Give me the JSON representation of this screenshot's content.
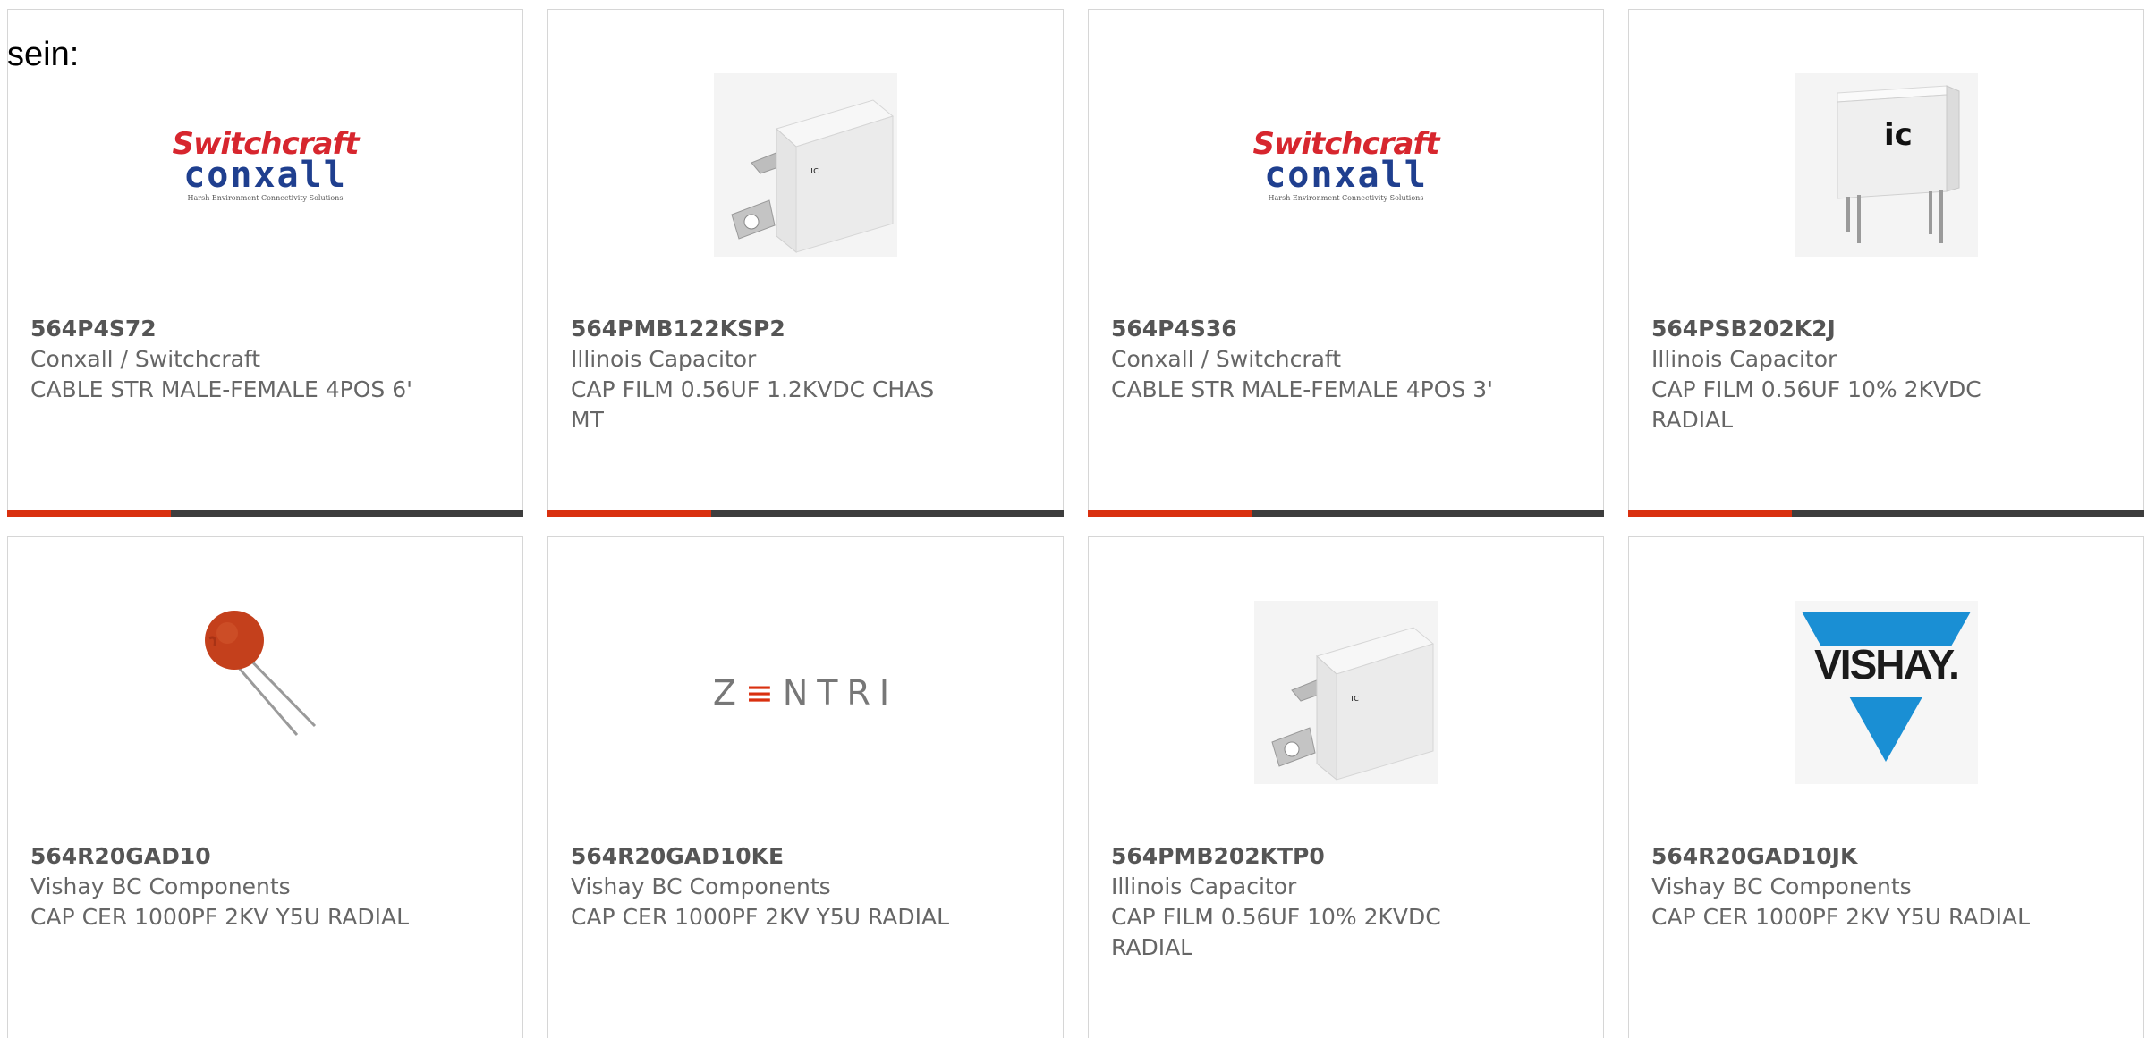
{
  "intro": "sein:",
  "colors": {
    "accent": "#d9300f",
    "bar": "#3d3d3d",
    "border": "#d6d6d6",
    "text": "#666666"
  },
  "products": [
    {
      "part_number": "564P4S72",
      "manufacturer": "Conxall / Switchcraft",
      "description": "CABLE STR MALE-FEMALE 4POS 6'",
      "image": "switchcraft-conxall-logo"
    },
    {
      "part_number": "564PMB122KSP2",
      "manufacturer": "Illinois Capacitor",
      "description": "CAP FILM 0.56UF 1.2KVDC CHAS MT",
      "image": "chassis-mount-capacitor-photo"
    },
    {
      "part_number": "564P4S36",
      "manufacturer": "Conxall / Switchcraft",
      "description": "CABLE STR MALE-FEMALE 4POS 3'",
      "image": "switchcraft-conxall-logo"
    },
    {
      "part_number": "564PSB202K2J",
      "manufacturer": "Illinois Capacitor",
      "description": "CAP FILM 0.56UF 10% 2KVDC RADIAL",
      "image": "radial-film-capacitor-photo"
    },
    {
      "part_number": "564R20GAD10",
      "manufacturer": "Vishay BC Components",
      "description": "CAP CER 1000PF 2KV Y5U RADIAL",
      "image": "ceramic-disc-capacitor-photo"
    },
    {
      "part_number": "564R20GAD10KE",
      "manufacturer": "Vishay BC Components",
      "description": "CAP CER 1000PF 2KV Y5U RADIAL",
      "image": "zentri-logo"
    },
    {
      "part_number": "564PMB202KTP0",
      "manufacturer": "Illinois Capacitor",
      "description": "CAP FILM 0.56UF 10% 2KVDC RADIAL",
      "image": "chassis-mount-capacitor-photo"
    },
    {
      "part_number": "564R20GAD10JK",
      "manufacturer": "Vishay BC Components",
      "description": "CAP CER 1000PF 2KV Y5U RADIAL",
      "image": "vishay-logo"
    }
  ],
  "logos": {
    "switchcraft_top": "Switchcraft",
    "switchcraft_mid": "conxall",
    "switchcraft_tag": "Harsh Environment Connectivity Solutions",
    "zentri_pre": "Z",
    "zentri_e": "≡",
    "zentri_post": "NTRI",
    "vishay": "VISHAY.",
    "ic_mark": "ic"
  }
}
